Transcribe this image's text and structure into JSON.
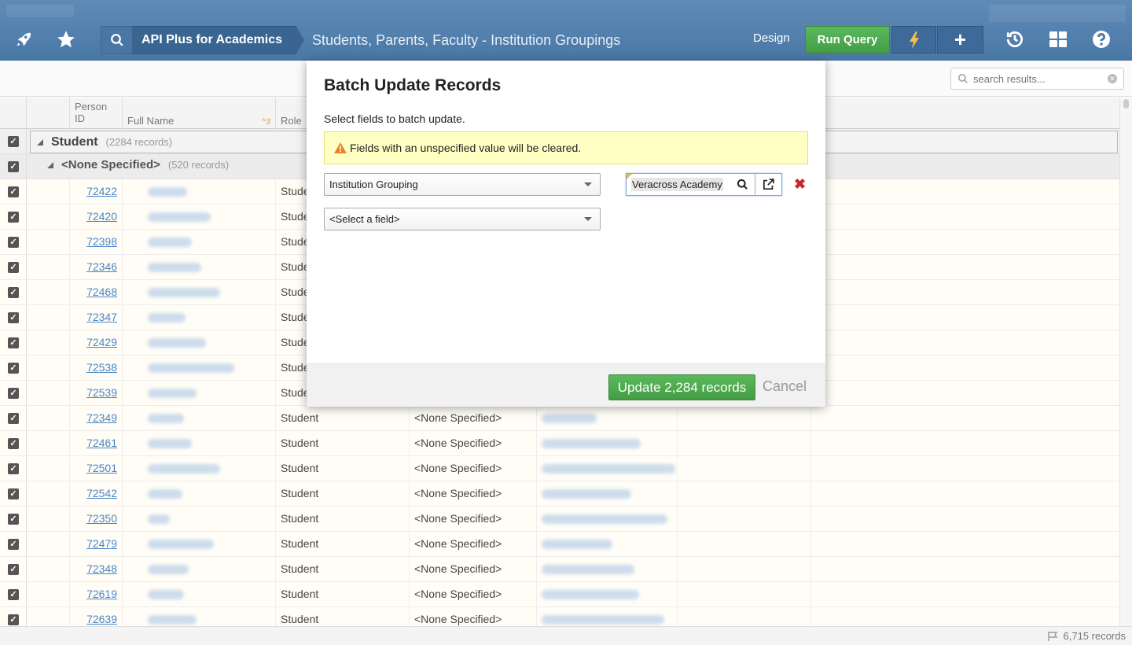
{
  "header": {
    "app_name": "API Plus for Academics",
    "page_title": "Students, Parents, Faculty - Institution Groupings",
    "design_label": "Design",
    "run_query_label": "Run Query",
    "plus_label": "+",
    "icons": [
      "rocket-icon",
      "star-icon",
      "search-icon",
      "bolt-icon",
      "history-icon",
      "grid-icon",
      "help-icon"
    ]
  },
  "toolbar": {
    "search_placeholder": "search results..."
  },
  "grid": {
    "columns": {
      "person_id": "Person",
      "person_id_2": "ID",
      "full_name": "Full Name",
      "sort_indicator": "^3",
      "role": "Role"
    },
    "group1": {
      "label": "Student",
      "count": "(2284 records)"
    },
    "group2": {
      "label": "<None Specified>",
      "count": "(520 records)"
    },
    "rows": [
      {
        "id": "72422",
        "role": "Stude",
        "inst": ""
      },
      {
        "id": "72420",
        "role": "Stude",
        "inst": ""
      },
      {
        "id": "72398",
        "role": "Stude",
        "inst": ""
      },
      {
        "id": "72346",
        "role": "Stude",
        "inst": ""
      },
      {
        "id": "72468",
        "role": "Stude",
        "inst": ""
      },
      {
        "id": "72347",
        "role": "Stude",
        "inst": ""
      },
      {
        "id": "72429",
        "role": "Stude",
        "inst": ""
      },
      {
        "id": "72538",
        "role": "Stude",
        "inst": ""
      },
      {
        "id": "72539",
        "role": "Stude",
        "inst": ""
      },
      {
        "id": "72349",
        "role": "Student",
        "inst": "<None Specified>"
      },
      {
        "id": "72461",
        "role": "Student",
        "inst": "<None Specified>"
      },
      {
        "id": "72501",
        "role": "Student",
        "inst": "<None Specified>"
      },
      {
        "id": "72542",
        "role": "Student",
        "inst": "<None Specified>"
      },
      {
        "id": "72350",
        "role": "Student",
        "inst": "<None Specified>"
      },
      {
        "id": "72479",
        "role": "Student",
        "inst": "<None Specified>"
      },
      {
        "id": "72348",
        "role": "Student",
        "inst": "<None Specified>"
      },
      {
        "id": "72619",
        "role": "Student",
        "inst": "<None Specified>"
      },
      {
        "id": "72639",
        "role": "Student",
        "inst": "<None Specified>"
      }
    ]
  },
  "footer": {
    "record_count": "6,715 records"
  },
  "modal": {
    "title": "Batch Update Records",
    "intro": "Select fields to batch update.",
    "warning": "Fields with an unspecified value will be cleared.",
    "field1": "Institution Grouping",
    "field1_value": "Veracross Academy",
    "field2": "<Select a field>",
    "remove_label": "✖",
    "update_label": "Update 2,284 records",
    "cancel_label": "Cancel"
  },
  "colors": {
    "header_blue": "#5f8bb6",
    "run_query_green": "#5bb85d",
    "link_blue": "#4a86c6",
    "warning_yellow": "#ffffc4",
    "remove_red": "#c62b2b"
  }
}
